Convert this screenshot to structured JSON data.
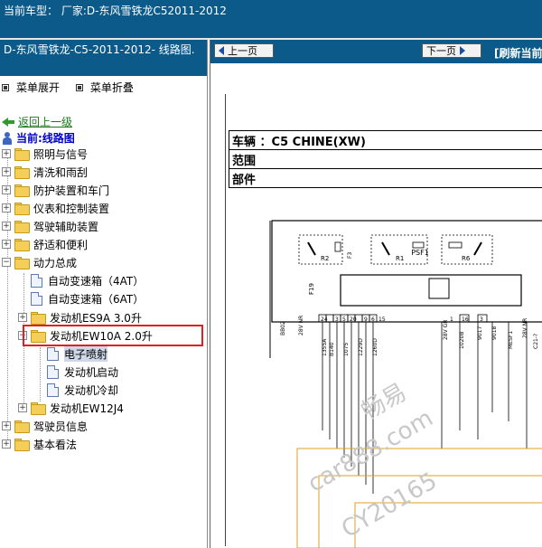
{
  "top": {
    "vehicle_label": "当前车型：",
    "vehicle_value": "厂家:D-东风雪铁龙C52011-2012"
  },
  "left": {
    "title": "D-东风雪铁龙-C5-2011-2012- 线路图.",
    "menu_expand": "菜单展开",
    "menu_collapse": "菜单折叠",
    "back_link": "返回上一级",
    "current_label": "当前:线路图",
    "tree": [
      {
        "label": "照明与信号"
      },
      {
        "label": "清洗和雨刮"
      },
      {
        "label": "防护装置和车门"
      },
      {
        "label": "仪表和控制装置"
      },
      {
        "label": "驾驶辅助装置"
      },
      {
        "label": "舒适和便利"
      },
      {
        "label": "动力总成"
      },
      {
        "label": "自动变速箱（4AT）"
      },
      {
        "label": "自动变速箱（6AT）"
      },
      {
        "label": "发动机ES9A 3.0升"
      },
      {
        "label": "发动机EW10A 2.0升"
      },
      {
        "label": "电子喷射"
      },
      {
        "label": "发动机启动"
      },
      {
        "label": "发动机冷却"
      },
      {
        "label": "发动机EW12J4"
      },
      {
        "label": "驾驶员信息"
      },
      {
        "label": "基本看法"
      }
    ]
  },
  "right": {
    "prev_page": "上一页",
    "next_page": "下一页",
    "refresh": "[刷新当前",
    "info": {
      "vehicle_label": "车辆",
      "vehicle_value": "：C5 CHINE(XW)",
      "range_label": "范围",
      "part_label": "部件"
    },
    "diagram": {
      "module": "PSF1",
      "relays": [
        "R2",
        "R1",
        "R6"
      ],
      "fuses": [
        "F19",
        "F3"
      ],
      "connector_pins": [
        "24",
        "3",
        "5",
        "20",
        "9",
        "6",
        "15",
        "1",
        "16",
        "3"
      ],
      "wire_codes": [
        "BB02",
        "28V NR",
        "1355A",
        "B140",
        "1075",
        "1229D",
        "1260D",
        "28V GR",
        "1020B",
        "9017",
        "9018",
        "MESF1",
        "28V NR",
        "C21-?"
      ]
    },
    "watermark": [
      "畅易",
      "car888.com",
      "CY20165"
    ]
  },
  "colors": {
    "header_blue": "#0b5a8a",
    "highlight_red": "#e02020",
    "folder_yellow": "#f3cf5a"
  }
}
